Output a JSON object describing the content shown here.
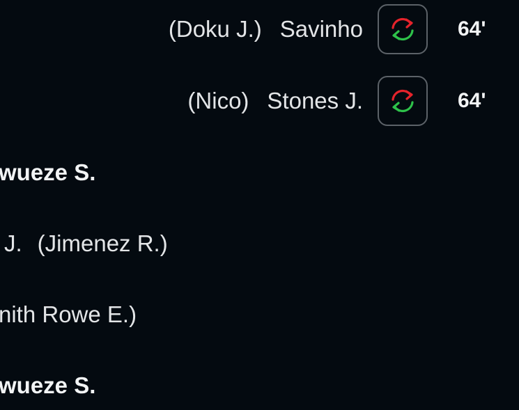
{
  "away_substitutions": [
    {
      "player_out": "(Doku J.)",
      "player_in": "Savinho",
      "icon": "substitution-icon",
      "minute": "64'"
    },
    {
      "player_out": "(Nico)",
      "player_in": "Stones J.",
      "icon": "substitution-icon",
      "minute": "64'"
    }
  ],
  "home_events": [
    {
      "type": "bold",
      "text": "wueze S."
    },
    {
      "type": "sub",
      "player_in": "J.",
      "player_out": "(Jimenez R.)"
    },
    {
      "type": "text",
      "text": "nith Rowe E.)"
    },
    {
      "type": "bold",
      "text": "wueze S."
    }
  ],
  "colors": {
    "background": "#040a10",
    "sub_arrow_out": "#e5232b",
    "sub_arrow_in": "#2ec24a",
    "icon_border": "#5c6268"
  }
}
